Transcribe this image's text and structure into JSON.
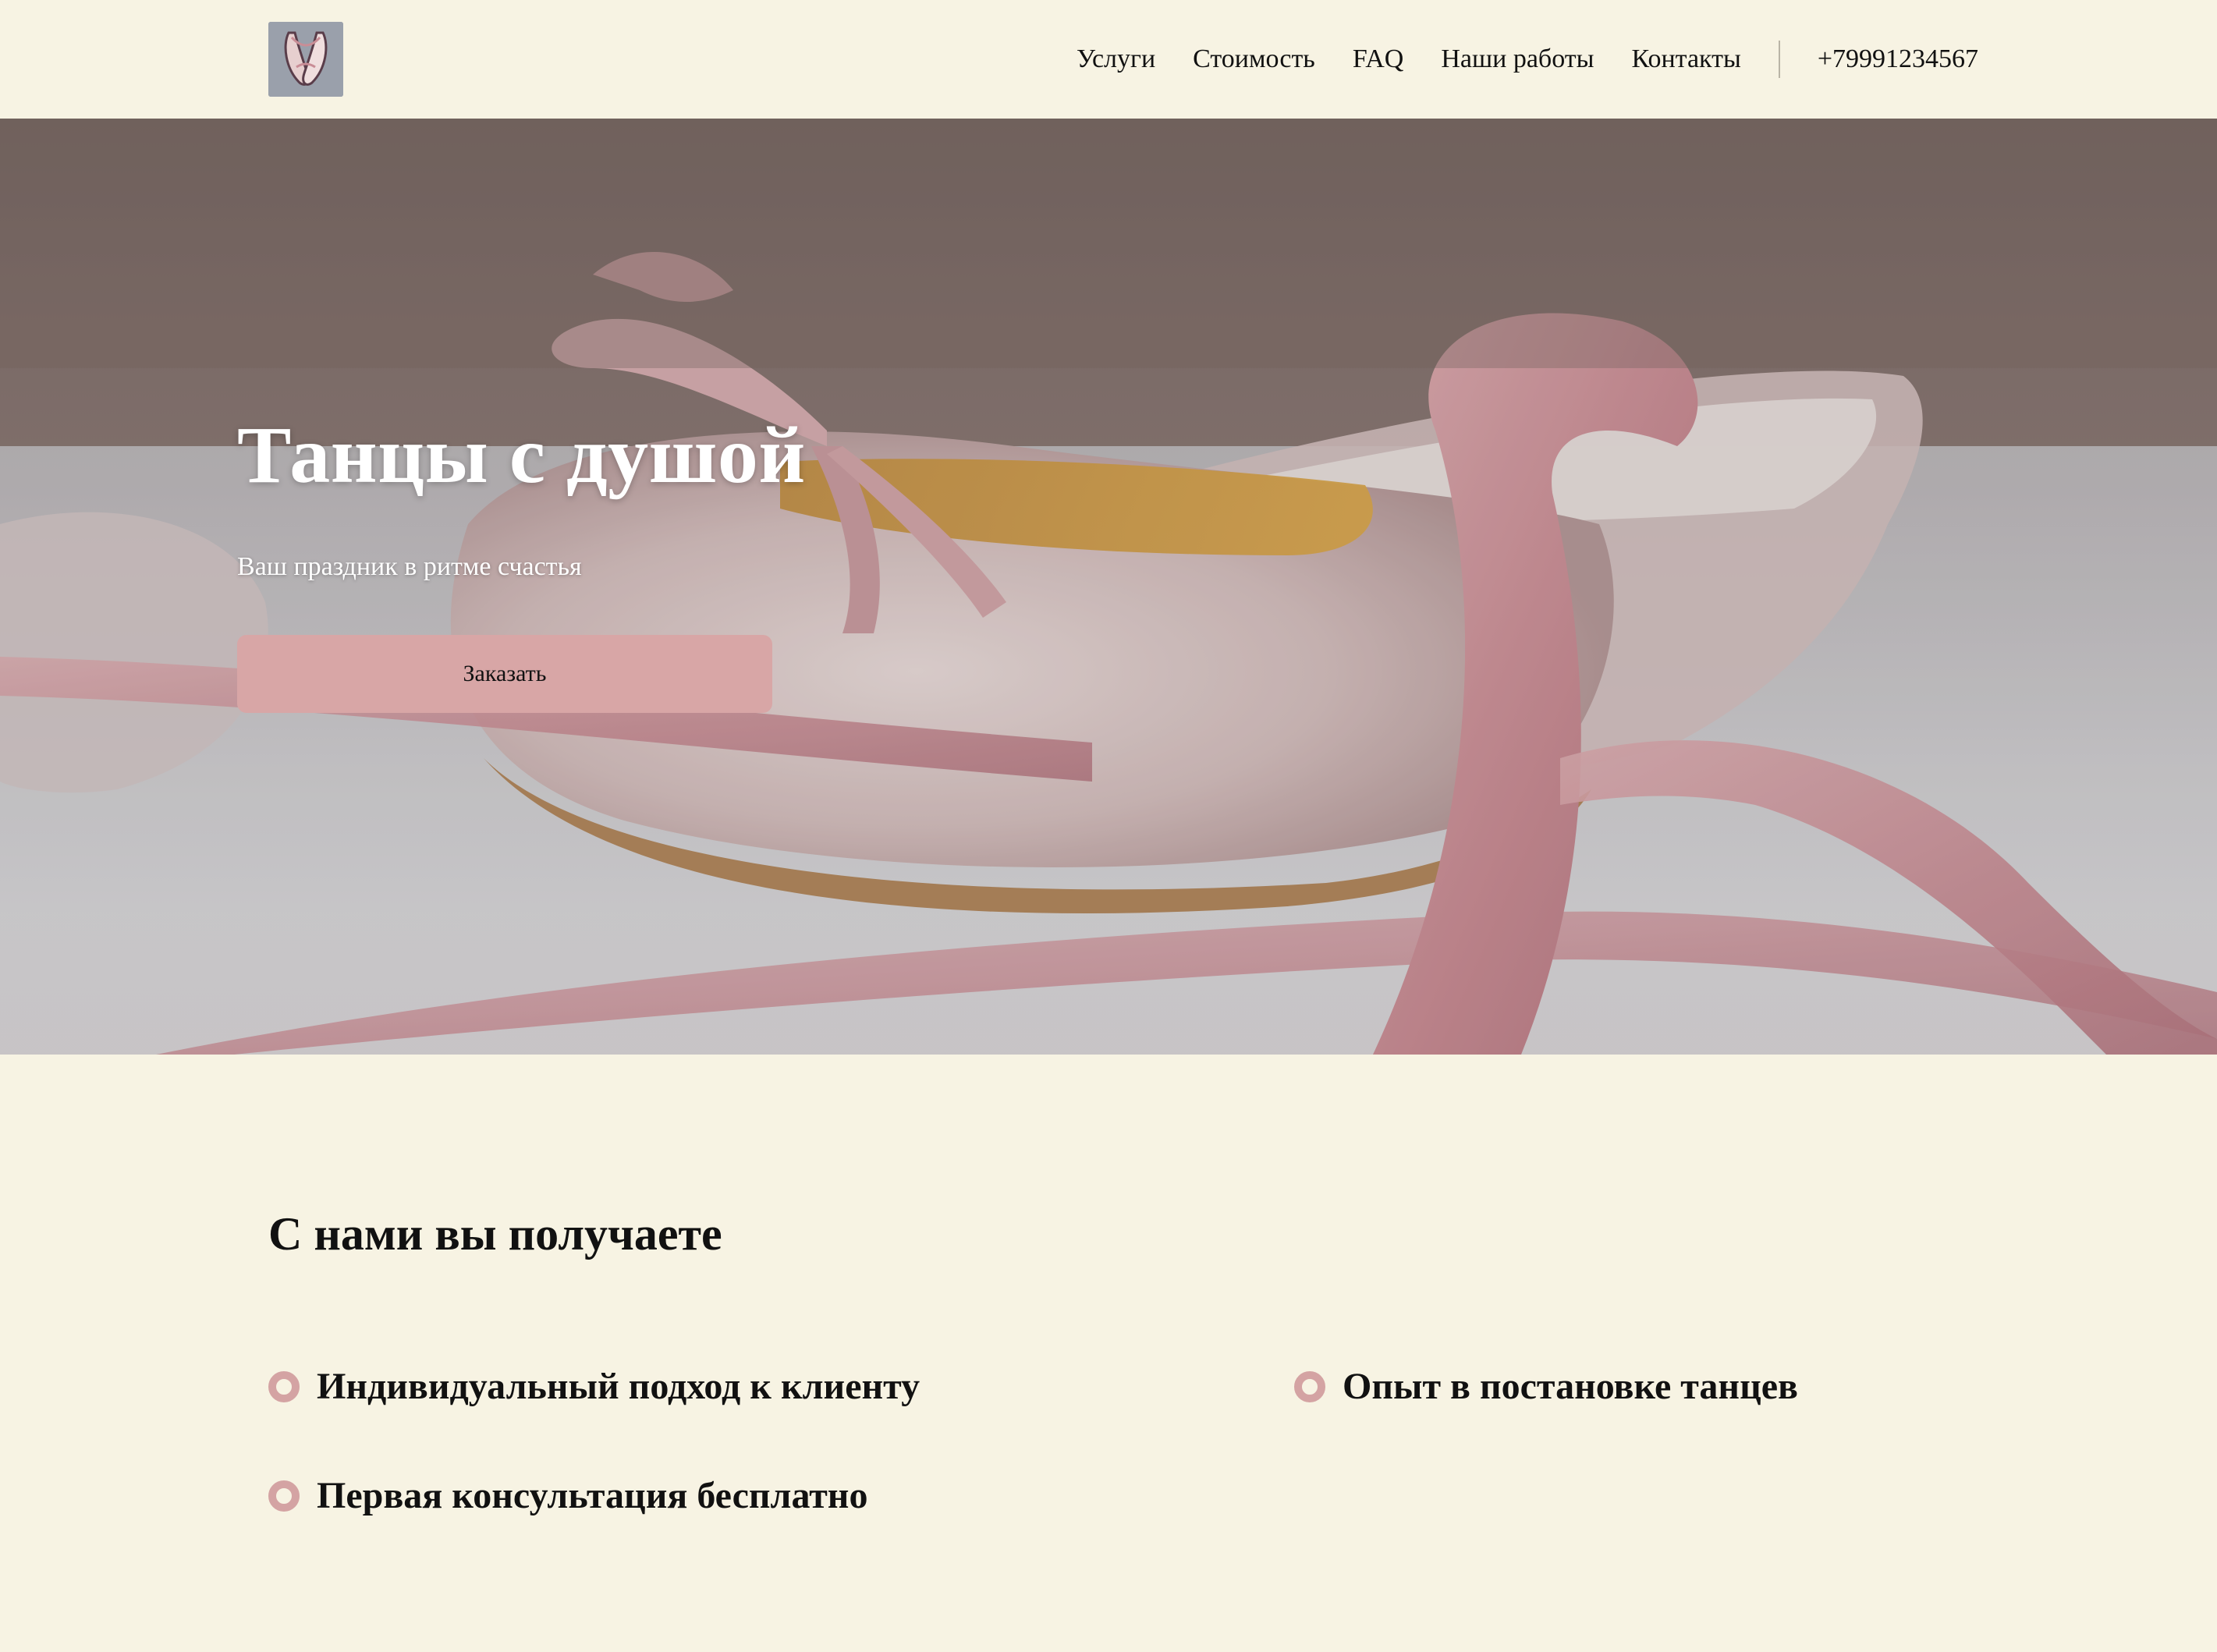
{
  "header": {
    "logo_alt": "logo",
    "nav": [
      {
        "label": "Услуги"
      },
      {
        "label": "Стоимость"
      },
      {
        "label": "FAQ"
      },
      {
        "label": "Наши работы"
      },
      {
        "label": "Контакты"
      }
    ],
    "phone": "+79991234567"
  },
  "hero": {
    "title": "Танцы с душой",
    "subtitle": "Ваш праздник в ритме счастья",
    "cta_label": "Заказать",
    "image_subject": "ballet-shoes-with-pink-ribbons"
  },
  "benefits": {
    "title": "С нами вы получаете",
    "items": [
      {
        "text": "Индивидуальный подход к клиенту"
      },
      {
        "text": "Опыт в постановке танцев"
      },
      {
        "text": "Первая консультация бесплатно"
      }
    ]
  },
  "colors": {
    "background": "#f7f3e3",
    "accent": "#d8a6a6",
    "bullet": "#d4a3a3",
    "text": "#111111"
  }
}
